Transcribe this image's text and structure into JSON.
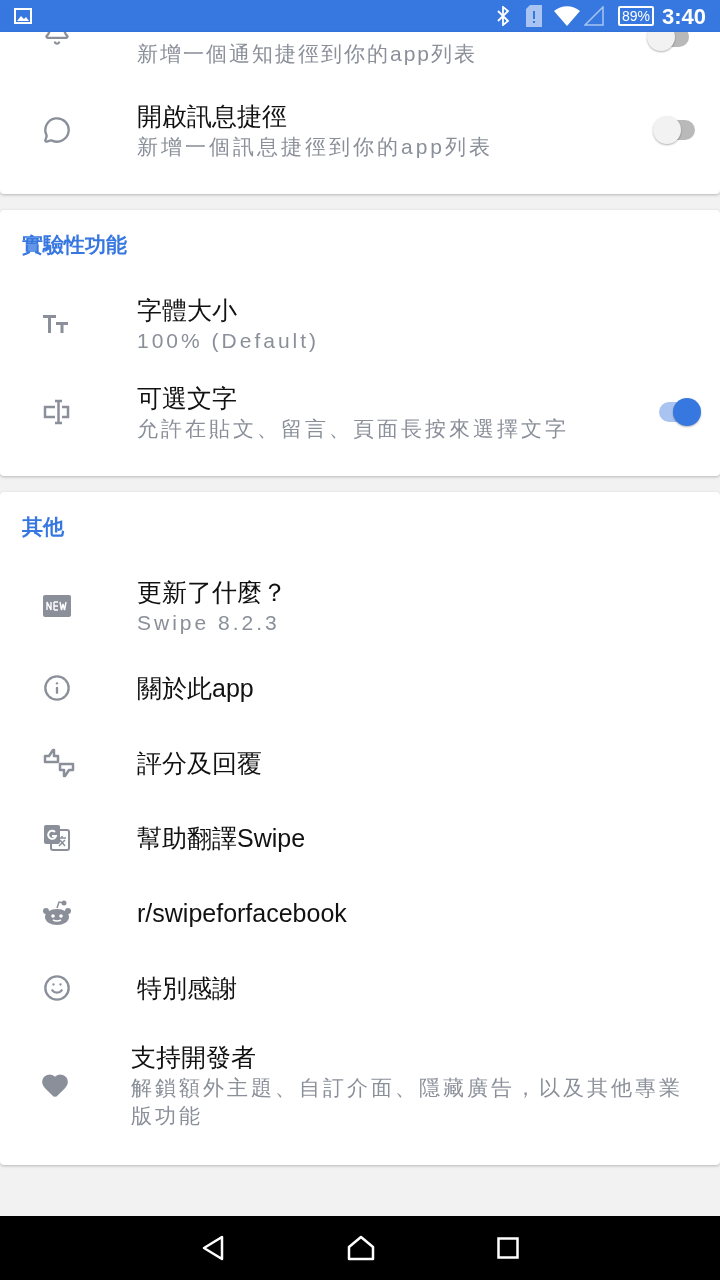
{
  "status_bar": {
    "battery": "89%",
    "time": "3:40"
  },
  "sections": [
    {
      "items": [
        {
          "kind": "toggle",
          "subtitle": "新增一個通知捷徑到你的app列表",
          "on": false
        },
        {
          "kind": "toggle",
          "title": "開啟訊息捷徑",
          "subtitle": "新增一個訊息捷徑到你的app列表",
          "on": false
        }
      ]
    },
    {
      "header": "實驗性功能",
      "items": [
        {
          "kind": "plain",
          "title": "字體大小",
          "subtitle": "100% (Default)"
        },
        {
          "kind": "toggle",
          "title": "可選文字",
          "subtitle": "允許在貼文、留言、頁面長按來選擇文字",
          "on": true
        }
      ]
    },
    {
      "header": "其他",
      "items": [
        {
          "kind": "plain",
          "title": "更新了什麼？",
          "subtitle": "Swipe 8.2.3"
        },
        {
          "kind": "plain",
          "title": "關於此app"
        },
        {
          "kind": "plain",
          "title": "評分及回覆"
        },
        {
          "kind": "plain",
          "title": "幫助翻譯Swipe"
        },
        {
          "kind": "plain",
          "title": "r/swipeforfacebook"
        },
        {
          "kind": "plain",
          "title": "特別感謝"
        },
        {
          "kind": "plain",
          "title": "支持開發者",
          "subtitle": "解鎖額外主題、自訂介面、隱藏廣告，以及其他專業版功能"
        }
      ]
    }
  ]
}
